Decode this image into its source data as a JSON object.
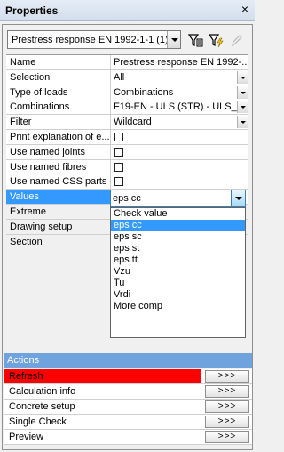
{
  "window": {
    "title": "Properties",
    "close_glyph": "×"
  },
  "toolbar": {
    "combo_value": "Prestress response EN 1992-1-1 (1)",
    "icons": [
      "filter-settings-icon",
      "filter-add-icon",
      "edit-icon"
    ]
  },
  "properties": [
    {
      "label": "Name",
      "value": "Prestress response EN 1992-...",
      "type": "text"
    },
    {
      "label": "Selection",
      "value": "All",
      "type": "dropdown"
    },
    {
      "label": "Type of loads",
      "value": "Combinations",
      "type": "dropdown"
    },
    {
      "label": "Combinations",
      "value": "F19-EN - ULS (STR) - ULS_...",
      "type": "dropdown"
    },
    {
      "label": "Filter",
      "value": "Wildcard",
      "type": "dropdown"
    },
    {
      "label": "Print explanation of e...",
      "value": "",
      "type": "checkbox"
    },
    {
      "label": "Use named joints",
      "value": "",
      "type": "checkbox"
    },
    {
      "label": "Use named fibres",
      "value": "",
      "type": "checkbox"
    },
    {
      "label": "Use named CSS parts",
      "value": "",
      "type": "checkbox"
    },
    {
      "label": "Values",
      "value": "eps cc",
      "type": "open-dropdown"
    },
    {
      "label": "Extreme",
      "value": "",
      "type": "text"
    },
    {
      "label": "Drawing setup",
      "value": "",
      "type": "text"
    },
    {
      "label": "Section",
      "value": "",
      "type": "text"
    }
  ],
  "values_dropdown": {
    "selected": "eps cc",
    "options": [
      "Check value",
      "eps cc",
      "eps sc",
      "eps st",
      "eps tt",
      "Vzu",
      "Tu",
      "Vrdi",
      "More comp"
    ]
  },
  "actions": {
    "header": "Actions",
    "button_label": ">>>",
    "items": [
      "Refresh",
      "Calculation info",
      "Concrete setup",
      "Single Check",
      "Preview"
    ]
  },
  "colors": {
    "selection": "#3399ff",
    "actions_header": "#6ea3dd",
    "refresh_highlight": "#ff0000"
  }
}
